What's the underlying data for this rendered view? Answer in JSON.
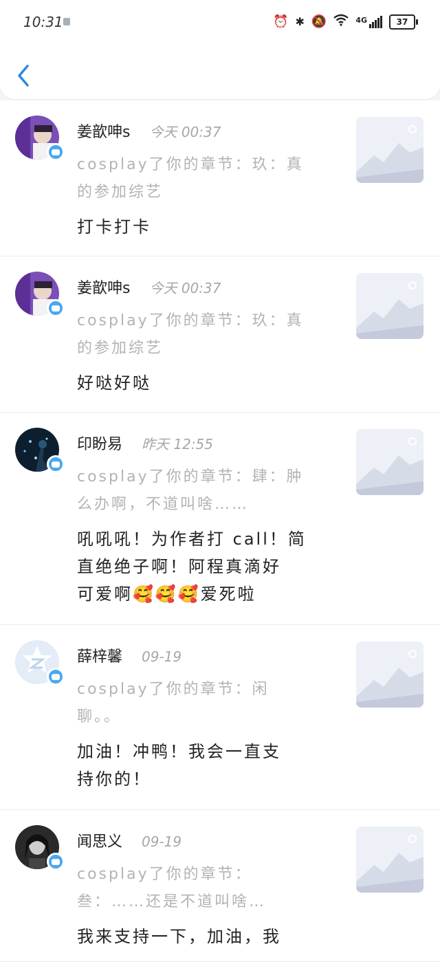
{
  "status_bar": {
    "time": "10:31",
    "battery": "37",
    "network": "4G"
  },
  "nav": {
    "back_icon": "chevron-left-icon"
  },
  "comments": [
    {
      "name": "姜歆呻s",
      "time": "今天 00:37",
      "ref_line1": "cosplay了你的章节：玖：真",
      "ref_line2": "的参加综艺",
      "msg_line1": "打卡打卡",
      "msg_line2": "",
      "msg_line3": ""
    },
    {
      "name": "姜歆呻s",
      "time": "今天 00:37",
      "ref_line1": "cosplay了你的章节：玖：真",
      "ref_line2": "的参加综艺",
      "msg_line1": "好哒好哒",
      "msg_line2": "",
      "msg_line3": ""
    },
    {
      "name": "印盼易",
      "time": "昨天 12:55",
      "ref_line1": "cosplay了你的章节：肆：肿",
      "ref_line2": "么办啊，不道叫啥……",
      "msg_line1": "吼吼吼！为作者打 call！简",
      "msg_line2": "直绝绝子啊！阿程真滴好",
      "msg_line3": "可爱啊🥰🥰🥰爱死啦"
    },
    {
      "name": "薛梓馨",
      "time": "09-19",
      "ref_line1": "cosplay了你的章节：闲",
      "ref_line2": "聊。。",
      "msg_line1": "加油！冲鸭！我会一直支",
      "msg_line2": "持你的！",
      "msg_line3": ""
    },
    {
      "name": "闻思义",
      "time": "09-19",
      "ref_line1": "cosplay了你的章节：",
      "ref_line2": "叁：……还是不道叫啥…",
      "msg_line1": "我来支持一下，加油，我",
      "msg_line2": "",
      "msg_line3": ""
    }
  ]
}
